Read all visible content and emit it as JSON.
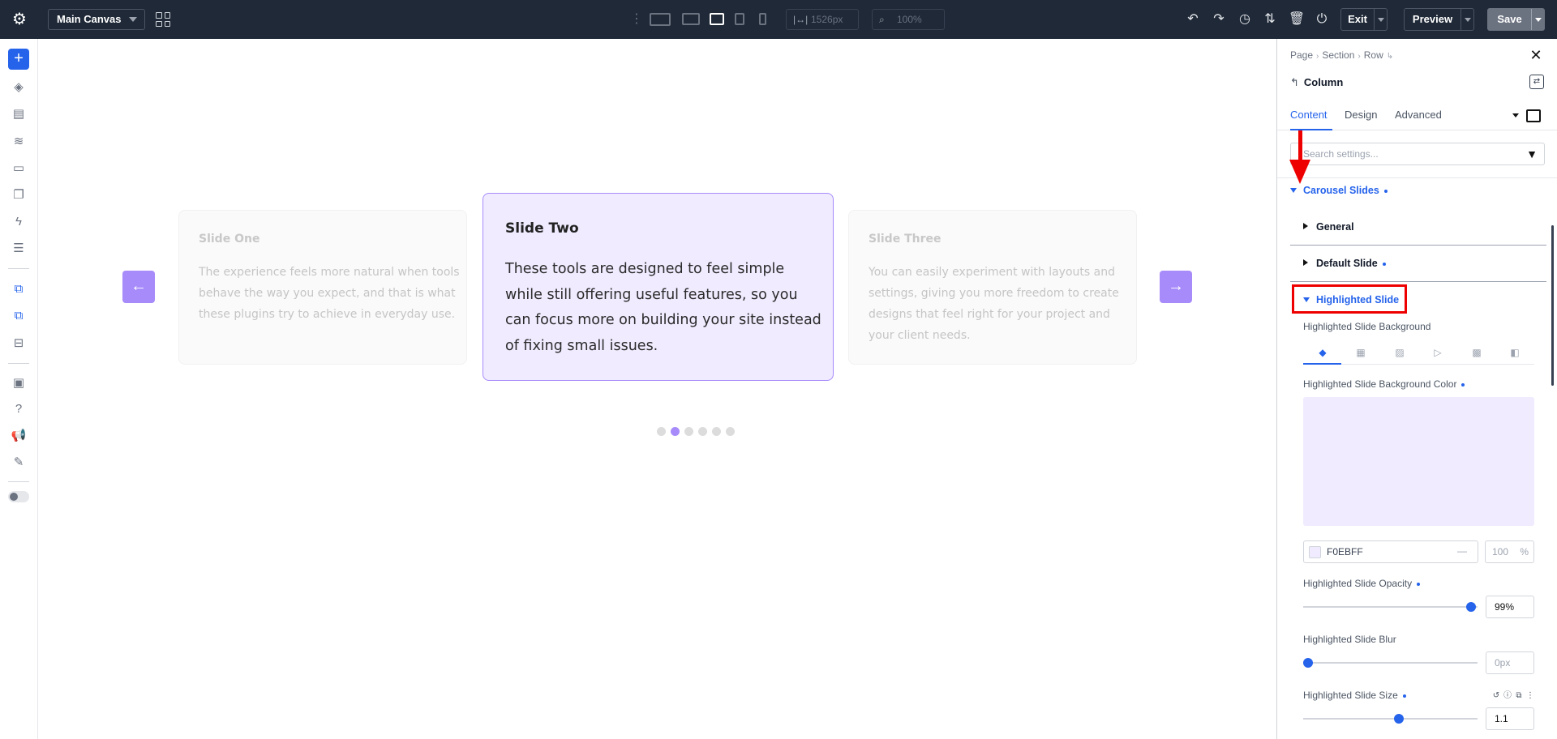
{
  "topbar": {
    "canvas_select": "Main Canvas",
    "width_value": "1526px",
    "zoom_value": "100%",
    "exit_label": "Exit",
    "preview_label": "Preview",
    "save_label": "Save"
  },
  "canvas": {
    "slides": [
      {
        "title": "Slide One",
        "body": "The experience feels more natural when tools behave the way you expect, and that is what these plugins try to achieve in everyday use."
      },
      {
        "title": "Slide Two",
        "body": "These tools are designed to feel simple while still offering useful features, so you can focus more on building your site instead of fixing small issues."
      },
      {
        "title": "Slide Three",
        "body": "You can easily experiment with layouts and settings, giving you more freedom to create designs that feel right for your project and your client needs."
      }
    ],
    "prev_arrow": "←",
    "next_arrow": "→",
    "active_dot": 2,
    "dot_count": 6
  },
  "panel": {
    "breadcrumb": [
      "Page",
      "Section",
      "Row"
    ],
    "module_name": "Column",
    "tabs": [
      "Content",
      "Design",
      "Advanced"
    ],
    "active_tab": "Content",
    "search_placeholder": "Search settings...",
    "group_title": "Carousel Slides",
    "subgroups": [
      "General",
      "Default Slide",
      "Highlighted Slide"
    ],
    "fields": {
      "bg_label": "Highlighted Slide Background",
      "bg_color_label": "Highlighted Slide Background Color",
      "bg_color_hex": "F0EBFF",
      "bg_color_alpha_placeholder": "100",
      "bg_color_alpha_unit": "%",
      "opacity_label": "Highlighted Slide Opacity",
      "opacity_value": "99%",
      "blur_label": "Highlighted Slide Blur",
      "blur_placeholder": "0px",
      "size_label": "Highlighted Slide Size",
      "size_value": "1.1"
    },
    "slider_levels": {
      "opacity": 0.99,
      "blur": 0.0,
      "size": 0.55
    }
  },
  "colors": {
    "accent": "#2563eb",
    "slide_highlight_bg": "#f0ebff",
    "slide_highlight_border": "#a78bfa",
    "annotation_red": "#ef0000"
  }
}
